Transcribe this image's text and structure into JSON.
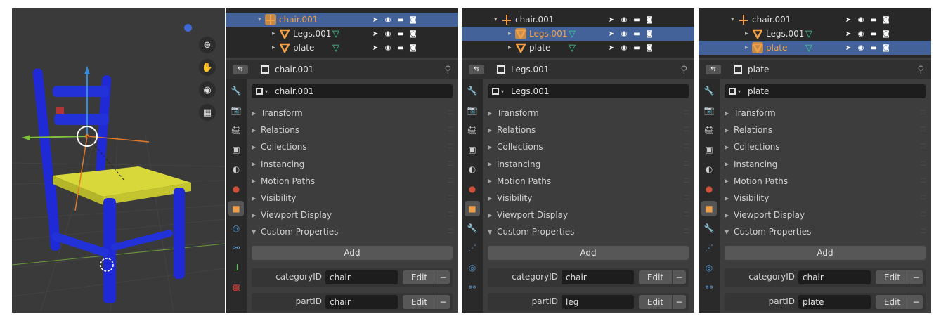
{
  "viewport": {
    "tools": [
      "zoom-icon",
      "hand-pan-icon",
      "camera-icon",
      "grid-ortho-icon"
    ],
    "colors": {
      "chair_frame": "#1f2ad6",
      "seat": "#d8d83a",
      "background": "#3a3a3a"
    }
  },
  "common": {
    "sections": [
      "Transform",
      "Relations",
      "Collections",
      "Instancing",
      "Motion Paths",
      "Visibility",
      "Viewport Display",
      "Custom Properties"
    ],
    "add_label": "Add",
    "edit_label": "Edit",
    "remove_label": "−",
    "prop_labels": [
      "categoryID",
      "partID"
    ],
    "editor_type_icon": "properties-editor-icon",
    "pin_icon": "pin-icon"
  },
  "panels": [
    {
      "outliner": [
        {
          "name": "chair.001",
          "type": "empty",
          "selected": true,
          "active": true,
          "expanded": true
        },
        {
          "name": "Legs.001",
          "type": "mesh",
          "selected": false,
          "active": false,
          "expanded": false
        },
        {
          "name": "plate",
          "type": "mesh",
          "selected": false,
          "active": false,
          "expanded": false
        }
      ],
      "header_title": "chair.001",
      "object_name": "chair.001",
      "tabs": [
        "tool-icon",
        "render-icon",
        "output-icon",
        "view-layer-icon",
        "scene-icon",
        "world-icon",
        "object-icon",
        "physics-icon",
        "constraints-icon",
        "data-empty-icon",
        "texture-icon"
      ],
      "props": [
        {
          "label": "categoryID",
          "value": "chair"
        },
        {
          "label": "partID",
          "value": "chair"
        }
      ]
    },
    {
      "outliner": [
        {
          "name": "chair.001",
          "type": "empty",
          "selected": false,
          "active": false,
          "expanded": true
        },
        {
          "name": "Legs.001",
          "type": "mesh",
          "selected": true,
          "active": true,
          "expanded": false
        },
        {
          "name": "plate",
          "type": "mesh",
          "selected": false,
          "active": false,
          "expanded": false
        }
      ],
      "header_title": "Legs.001",
      "object_name": "Legs.001",
      "tabs": [
        "tool-icon",
        "render-icon",
        "output-icon",
        "view-layer-icon",
        "scene-icon",
        "world-icon",
        "object-icon",
        "modifier-icon",
        "particles-icon",
        "physics-icon",
        "constraints-icon"
      ],
      "props": [
        {
          "label": "categoryID",
          "value": "chair"
        },
        {
          "label": "partID",
          "value": "leg"
        }
      ]
    },
    {
      "outliner": [
        {
          "name": "chair.001",
          "type": "empty",
          "selected": false,
          "active": false,
          "expanded": true
        },
        {
          "name": "Legs.001",
          "type": "mesh",
          "selected": false,
          "active": false,
          "expanded": false
        },
        {
          "name": "plate",
          "type": "mesh",
          "selected": true,
          "active": true,
          "expanded": false
        }
      ],
      "header_title": "plate",
      "object_name": "plate",
      "tabs": [
        "tool-icon",
        "render-icon",
        "output-icon",
        "view-layer-icon",
        "scene-icon",
        "world-icon",
        "object-icon",
        "modifier-icon",
        "particles-icon",
        "physics-icon",
        "constraints-icon"
      ],
      "props": [
        {
          "label": "categoryID",
          "value": "chair"
        },
        {
          "label": "partID",
          "value": "plate"
        }
      ]
    }
  ]
}
